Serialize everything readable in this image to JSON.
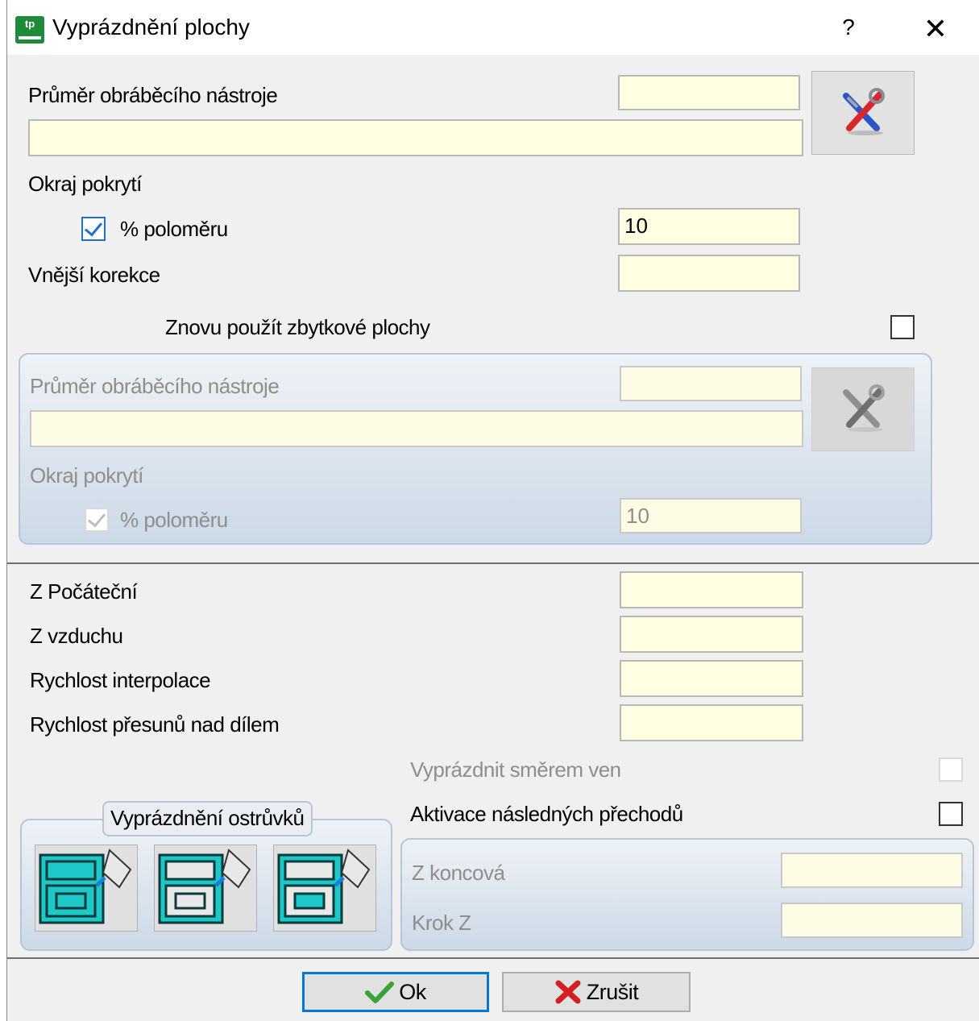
{
  "window": {
    "title": "Vyprázdnění plochy",
    "help_label": "?",
    "close_label": "✕",
    "icon_text": "tp"
  },
  "section1": {
    "tool_diameter_label": "Průměr obráběcího nástroje",
    "tool_diameter_value": "",
    "tool_name_value": "",
    "overlap_label": "Okraj pokrytí",
    "percent_radius_label": "% poloměru",
    "percent_radius_checked": true,
    "overlap_value": "10",
    "outer_correction_label": "Vnější korekce",
    "outer_correction_value": "",
    "reuse_residual_label": "Znovu použít zbytkové plochy",
    "reuse_residual_checked": false
  },
  "residual_group": {
    "tool_diameter_label": "Průměr obráběcího nástroje",
    "tool_diameter_value": "",
    "tool_name_value": "",
    "overlap_label": "Okraj pokrytí",
    "percent_radius_label": "% poloměru",
    "percent_radius_checked": true,
    "overlap_value": "10"
  },
  "section2": {
    "z_start_label": "Z Počáteční",
    "z_start_value": "",
    "z_air_label": "Z vzduchu",
    "z_air_value": "",
    "interp_speed_label": "Rychlost interpolace",
    "interp_speed_value": "",
    "rapid_speed_label": "Rychlost přesunů nad dílem",
    "rapid_speed_value": "",
    "empty_outward_label": "Vyprázdnit směrem ven",
    "empty_outward_checked": false,
    "activate_passes_label": "Aktivace následných přechodů",
    "activate_passes_checked": false,
    "z_end_label": "Z koncová",
    "z_end_value": "",
    "step_z_label": "Krok Z",
    "step_z_value": ""
  },
  "islands": {
    "legend": "Vyprázdnění ostrůvků"
  },
  "buttons": {
    "ok_label": "Ok",
    "cancel_label": "Zrušit"
  },
  "colors": {
    "field_bg": "#ffffe1",
    "accent": "#0078d7",
    "teal": "#1ec8c8",
    "ok_green": "#3aa336",
    "cancel_red": "#d42020"
  }
}
